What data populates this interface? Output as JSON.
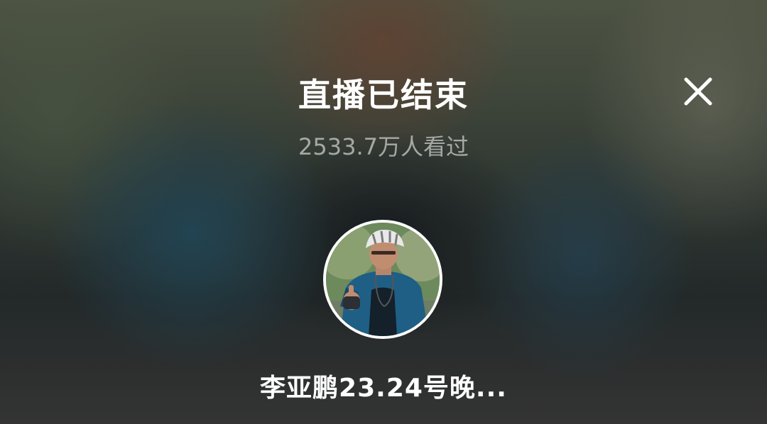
{
  "screen": {
    "title": "直播已结束",
    "viewer_count": "2533.7万人看过",
    "streamer_name": "李亚鹏23.24号晚...",
    "close_icon": "close-icon",
    "avatar_icon": "cyclist-avatar"
  }
}
